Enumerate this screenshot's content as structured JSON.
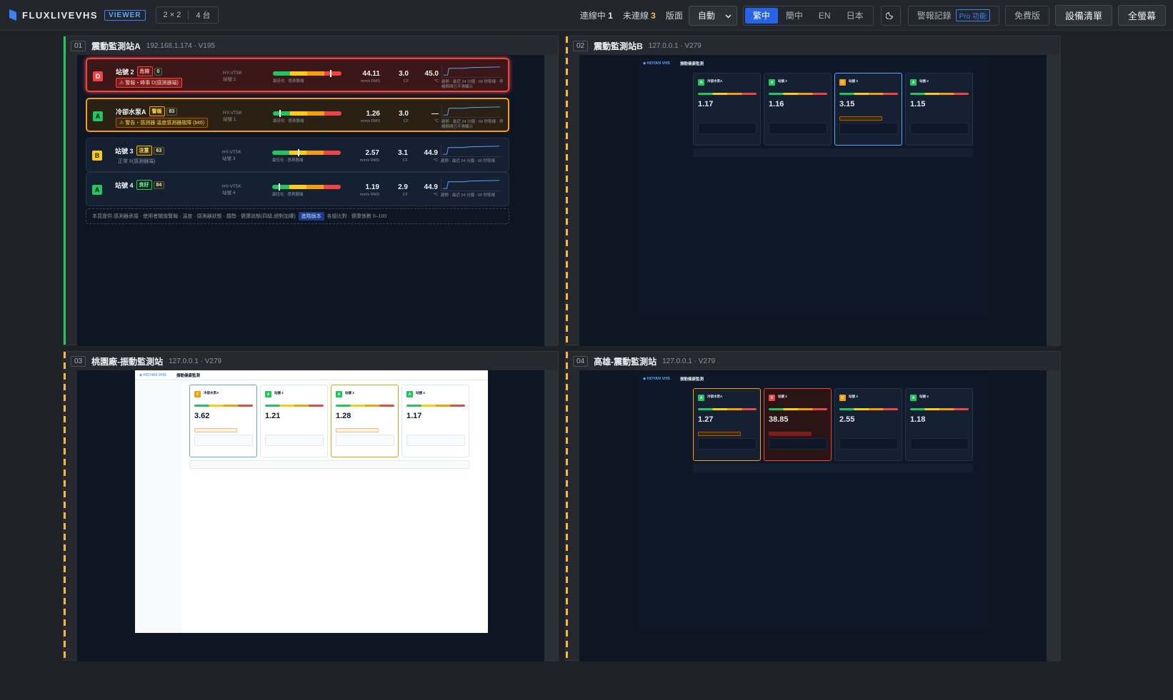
{
  "app": {
    "logo": "FLUXLIVEVHS",
    "mode_badge": "VIEWER",
    "layout_grid": "2 × 2",
    "layout_count": "4 台"
  },
  "topbar": {
    "connected_label": "連線中",
    "connected_count": "1",
    "disconnected_label": "未連線",
    "disconnected_count": "3",
    "layout_label": "版面",
    "layout_select_value": "自動",
    "languages": [
      {
        "label": "繁中",
        "active": true
      },
      {
        "label": "簡中",
        "active": false
      },
      {
        "label": "EN",
        "active": false
      },
      {
        "label": "日本",
        "active": false
      }
    ],
    "theme_icon": "moon-icon",
    "alarm_log_label": "警報記錄",
    "pro_badge": "Pro 功能",
    "free_label": "免費版",
    "device_list_label": "設備清單",
    "fullscreen_label": "全螢幕"
  },
  "panels": [
    {
      "num": "01",
      "title": "震動監測站A",
      "sub": "192.168.1.174 · V195",
      "status_color": "#22c55e",
      "stations": [
        {
          "grade": "D",
          "name": "站號 2",
          "badge": "危險",
          "score": "0",
          "alert": "⚠ 警報・峰事 D(感測器端)",
          "model": "HY-VT5K",
          "model_sub": "站號 2",
          "marker": 0.85,
          "bar_lbl": "最佳化 · 感測器端",
          "v1": "44.11",
          "u1": "mm/s RMS",
          "v2": "3.0",
          "u2": "CF",
          "v3": "45.0",
          "u3": "°C",
          "spark_lbl": "趨勢 · 最近 24 分鐘 · 60 秒取樣 · 停機期間已平滑顯示",
          "state": "danger"
        },
        {
          "grade": "A",
          "name": "冷卻水泵A",
          "badge": "警報",
          "score": "83",
          "alert": "⚠ 警告・感測器 溫度感測器故障 (bit6)",
          "model": "HY-VT5K",
          "model_sub": "站號 1",
          "marker": 0.1,
          "bar_lbl": "最佳化 · 感測器端",
          "v1": "1.26",
          "u1": "mm/s RMS",
          "v2": "3.0",
          "u2": "CF",
          "v3": "—",
          "u3": "°C",
          "spark_lbl": "趨勢 · 最近 24 分鐘 · 60 秒取樣 · 停機期間已平滑顯示",
          "state": "warning"
        },
        {
          "grade": "B",
          "name": "站號 3",
          "badge": "注意",
          "score": "63",
          "alert": "正常 II(感測器端)",
          "model": "HY-VT5K",
          "model_sub": "站號 3",
          "marker": 0.38,
          "bar_lbl": "最佳化 · 感測器端",
          "v1": "2.57",
          "u1": "mm/s RMS",
          "v2": "3.1",
          "u2": "CF",
          "v3": "44.9",
          "u3": "°C",
          "spark_lbl": "趨勢 · 最近 24 分鐘 · 60 秒取樣",
          "state": "normal"
        },
        {
          "grade": "A",
          "name": "站號 4",
          "badge": "良好",
          "score": "84",
          "alert": "",
          "model": "HY-VT5K",
          "model_sub": "站號 4",
          "marker": 0.1,
          "bar_lbl": "最佳化 · 感測器端",
          "v1": "1.19",
          "u1": "mm/s RMS",
          "v2": "2.9",
          "u2": "CF",
          "v3": "44.9",
          "u3": "°C",
          "spark_lbl": "趨勢 · 最近 24 分鐘 · 60 秒取樣",
          "state": "normal"
        }
      ],
      "footnote_a": "本頁提供:感測器承接 · 使用者閾值警報 · 溫度 · 感測器狀態 · 趨勢 · 健康狀態(四級,絕對加權)",
      "footnote_tag": "進階版本",
      "footnote_b": "各級比對 · 健康係數 0–100"
    },
    {
      "num": "02",
      "title": "震動監測站B",
      "sub": "127.0.0.1 · V279",
      "status_color": "#f5b942",
      "mini": {
        "logo": "◆ HOYAN VHS",
        "title": "振動健康監測",
        "cards": [
          {
            "grade": "A",
            "name": "冷卻水泵A",
            "value": "1.17",
            "sel": ""
          },
          {
            "grade": "A",
            "name": "站號 2",
            "value": "1.16",
            "sel": ""
          },
          {
            "grade": "C",
            "name": "站號 3",
            "value": "3.15",
            "sel": "sel-blue"
          },
          {
            "grade": "A",
            "name": "站號 4",
            "value": "1.15",
            "sel": ""
          }
        ]
      }
    },
    {
      "num": "03",
      "title": "桃園廠-振動監測站",
      "sub": "127.0.0.1 · V279",
      "status_color": "#f5b942",
      "mini": {
        "logo": "◆ HOYAN VHS",
        "title": "振動健康監測",
        "cards": [
          {
            "grade": "C",
            "name": "冷卻水泵A",
            "value": "3.62",
            "sel": "sel-blue"
          },
          {
            "grade": "A",
            "name": "站號 2",
            "value": "1.21",
            "sel": ""
          },
          {
            "grade": "A",
            "name": "站號 3",
            "value": "1.28",
            "sel": "sel-orange"
          },
          {
            "grade": "A",
            "name": "站號 4",
            "value": "1.17",
            "sel": ""
          }
        ]
      }
    },
    {
      "num": "04",
      "title": "高雄-震動監測站",
      "sub": "127.0.0.1 · V279",
      "status_color": "#f5b942",
      "mini": {
        "logo": "◆ HOYAN VHS",
        "title": "振動健康監測",
        "cards": [
          {
            "grade": "A",
            "name": "冷卻水泵A",
            "value": "1.27",
            "sel": "sel-orange"
          },
          {
            "grade": "D",
            "name": "站號 2",
            "value": "38.85",
            "sel": "sel-red"
          },
          {
            "grade": "C",
            "name": "站號 3",
            "value": "2.55",
            "sel": ""
          },
          {
            "grade": "A",
            "name": "站號 4",
            "value": "1.18",
            "sel": ""
          }
        ]
      }
    }
  ]
}
